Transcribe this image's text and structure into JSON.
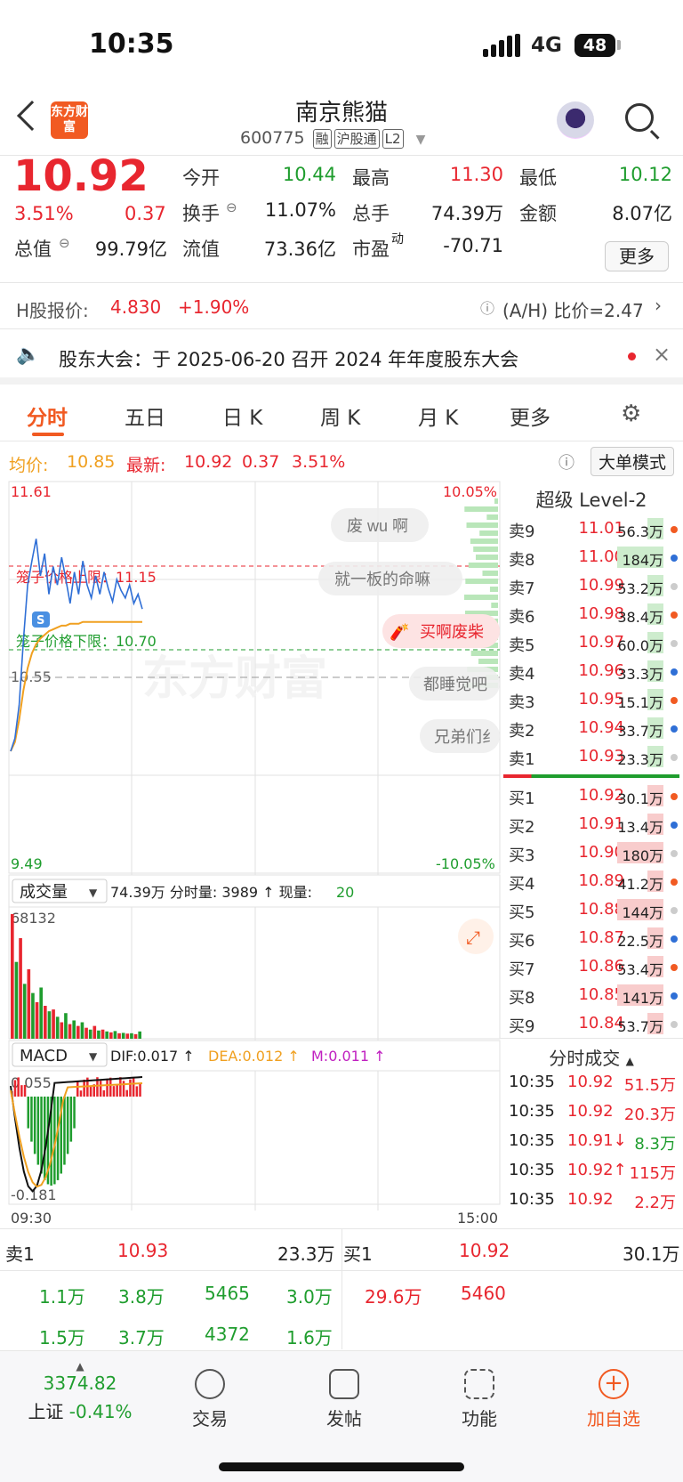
{
  "status": {
    "time": "10:35",
    "network": "4G",
    "battery": "48"
  },
  "header": {
    "stock_name": "南京熊猫",
    "code": "600775",
    "tags": [
      "融",
      "沪股通",
      "L2"
    ],
    "logo_text": "东方财富"
  },
  "quote": {
    "price": "10.92",
    "pct": "3.51%",
    "chg": "0.37",
    "cells": [
      [
        "今开",
        "10.44"
      ],
      [
        "最高",
        "11.30"
      ],
      [
        "最低",
        "10.12"
      ],
      [
        "换手",
        "11.07%"
      ],
      [
        "总手",
        "74.39万"
      ],
      [
        "金额",
        "8.07亿"
      ],
      [
        "总值",
        "99.79亿"
      ],
      [
        "流值",
        "73.36亿"
      ],
      [
        "市盈",
        "-70.71"
      ]
    ],
    "pe_sup": "动",
    "more": "更多"
  },
  "hshare": {
    "label": "H股报价:",
    "price": "4.830",
    "pct": "+1.90%",
    "ratio": "(A/H) 比价=2.47"
  },
  "notice": {
    "text": "股东大会：于 2025-06-20 召开 2024 年年度股东大会"
  },
  "tabs": [
    "分时",
    "五日",
    "日 K",
    "周 K",
    "月 K",
    "更多"
  ],
  "avg_line": {
    "avg_label": "均价:",
    "avg": "10.85",
    "last_label": "最新:",
    "last": "10.92",
    "chg": "0.37",
    "pct": "3.51%",
    "mode": "大单模式"
  },
  "chart_labels": {
    "top": "11.61",
    "bottom": "9.49",
    "top_pct": "10.05%",
    "bottom_pct": "-10.05%",
    "mid": "10.55",
    "upper_limit": "笼子价格上限：11.15",
    "lower_limit": "笼子价格下限：10.70",
    "watermark": "东方财富",
    "start": "09:30",
    "end": "15:00"
  },
  "comments": [
    "废 wu 啊",
    "就一板的命嘛",
    "买啊废柴",
    "都睡觉吧",
    "兄弟们纟"
  ],
  "volume": {
    "label": "成交量",
    "info": "74.39万  分时量: 3989 ↑ 现量: ",
    "now": "20",
    "max": "68132"
  },
  "macd": {
    "label": "MACD",
    "dif": "DIF:0.017 ↑",
    "dea": "DEA:0.012 ↑",
    "m": "M:0.011 ↑",
    "top": "0.055",
    "bottom": "-0.181"
  },
  "chart_data": {
    "type": "line",
    "x_range": [
      "09:30",
      "15:00"
    ],
    "ylim": [
      9.49,
      11.61
    ],
    "prev_close": 10.55,
    "upper_limit": 11.15,
    "lower_limit": 10.7,
    "price": [
      10.15,
      10.22,
      10.4,
      10.75,
      11.05,
      11.18,
      11.3,
      11.1,
      11.22,
      11.0,
      11.15,
      11.05,
      11.2,
      11.08,
      10.95,
      11.12,
      11.0,
      11.18,
      11.05,
      10.98,
      11.1,
      11.0,
      11.12,
      11.03,
      10.96,
      11.08,
      11.02,
      10.98,
      11.05,
      10.95,
      11.0,
      10.92
    ],
    "avg": [
      10.15,
      10.2,
      10.32,
      10.48,
      10.6,
      10.68,
      10.73,
      10.76,
      10.78,
      10.8,
      10.81,
      10.82,
      10.83,
      10.83,
      10.84,
      10.84,
      10.84,
      10.85,
      10.85,
      10.85,
      10.85,
      10.85,
      10.85,
      10.85,
      10.85,
      10.85,
      10.85,
      10.85,
      10.85,
      10.85,
      10.85,
      10.85
    ],
    "volume": [
      68132,
      42000,
      55000,
      30000,
      38000,
      25000,
      20000,
      28000,
      18000,
      15000,
      16000,
      12000,
      9000,
      14000,
      8000,
      10000,
      7000,
      9000,
      6000,
      5000,
      7000,
      4500,
      5000,
      4000,
      3500,
      4200,
      3000,
      3200,
      2800,
      3000,
      2500,
      3989
    ]
  },
  "orderbook": {
    "title": "超级 Level-2",
    "asks": [
      [
        "卖9",
        "11.01",
        "56.3万"
      ],
      [
        "卖8",
        "11.00",
        "184万"
      ],
      [
        "卖7",
        "10.99",
        "53.2万"
      ],
      [
        "卖6",
        "10.98",
        "38.4万"
      ],
      [
        "卖5",
        "10.97",
        "60.0万"
      ],
      [
        "卖4",
        "10.96",
        "33.3万"
      ],
      [
        "卖3",
        "10.95",
        "15.1万"
      ],
      [
        "卖2",
        "10.94",
        "33.7万"
      ],
      [
        "卖1",
        "10.93",
        "23.3万"
      ]
    ],
    "bids": [
      [
        "买1",
        "10.92",
        "30.1万"
      ],
      [
        "买2",
        "10.91",
        "13.4万"
      ],
      [
        "买3",
        "10.90",
        "180万"
      ],
      [
        "买4",
        "10.89",
        "41.2万"
      ],
      [
        "买5",
        "10.88",
        "144万"
      ],
      [
        "买6",
        "10.87",
        "22.5万"
      ],
      [
        "买7",
        "10.86",
        "53.4万"
      ],
      [
        "买8",
        "10.85",
        "141万"
      ],
      [
        "买9",
        "10.84",
        "53.7万"
      ]
    ]
  },
  "trades": {
    "title": "分时成交",
    "rows": [
      [
        "10:35",
        "10.92",
        "51.5万"
      ],
      [
        "10:35",
        "10.92",
        "20.3万"
      ],
      [
        "10:35",
        "10.91↓",
        "8.3万"
      ],
      [
        "10:35",
        "10.92↑",
        "115万"
      ],
      [
        "10:35",
        "10.92",
        "2.2万"
      ]
    ]
  },
  "level2": {
    "sell_label": "卖1",
    "sell_price": "10.93",
    "sell_vol": "23.3万",
    "buy_label": "买1",
    "buy_price": "10.92",
    "buy_vol": "30.1万",
    "sell_q1": [
      "1.1万",
      "3.8万",
      "5465",
      "3.0万"
    ],
    "sell_q2": [
      "1.5万",
      "3.7万",
      "4372",
      "1.6万"
    ],
    "buy_q1": [
      "29.6万",
      "5460"
    ]
  },
  "nav": {
    "index": "3374.82",
    "index_name": "上证",
    "index_pct": "-0.41%",
    "items": [
      "交易",
      "发帖",
      "功能",
      "加自选"
    ]
  }
}
